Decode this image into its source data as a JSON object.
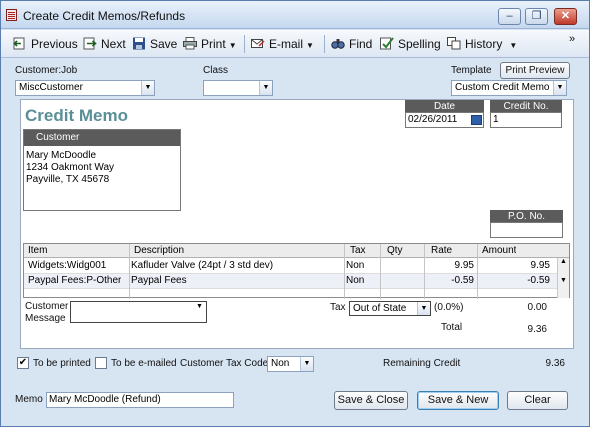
{
  "window": {
    "title": "Create Credit Memos/Refunds",
    "controls": {
      "minimize": "–",
      "restore": "❐",
      "close": "✕"
    }
  },
  "toolbar": {
    "previous": "Previous",
    "next": "Next",
    "save": "Save",
    "print": "Print",
    "email": "E-mail",
    "find": "Find",
    "spelling": "Spelling",
    "history": "History",
    "overflow": "»"
  },
  "customer": {
    "label": "Customer:Job",
    "value": "MiscCustomer"
  },
  "class": {
    "label": "Class",
    "value": ""
  },
  "template": {
    "label": "Template",
    "value": "Custom Credit Memo",
    "preview_button": "Print Preview"
  },
  "form": {
    "title": "Credit Memo",
    "date_label": "Date",
    "date": "02/26/2011",
    "credit_no_label": "Credit No.",
    "credit_no": "1",
    "customer_header": "Customer",
    "address": [
      "Mary McDoodle",
      "1234 Oakmont Way",
      "Payville, TX 45678"
    ],
    "po_label": "P.O. No.",
    "po_value": ""
  },
  "items_table": {
    "headers": [
      "Item",
      "Description",
      "Tax",
      "Qty",
      "Rate",
      "Amount"
    ],
    "rows": [
      {
        "item": "Widgets:Widg001",
        "description": "Kafluder Valve (24pt / 3 std dev)",
        "tax": "Non",
        "qty": "",
        "rate": "9.95",
        "amount": "9.95"
      },
      {
        "item": "Paypal Fees:P-Other",
        "description": "Paypal Fees",
        "tax": "Non",
        "qty": "",
        "rate": "-0.59",
        "amount": "-0.59"
      }
    ]
  },
  "customer_message": {
    "label_line1": "Customer",
    "label_line2": "Message",
    "value": ""
  },
  "tax": {
    "label": "Tax",
    "value": "Out of State",
    "rate": "(0.0%)",
    "amount": "0.00"
  },
  "total": {
    "label": "Total",
    "value": "9.36"
  },
  "options": {
    "to_be_printed": "To be printed",
    "to_be_printed_checked": true,
    "to_be_emailed": "To be e-mailed",
    "to_be_emailed_checked": false,
    "customer_tax_code_label": "Customer Tax Code",
    "customer_tax_code": "Non",
    "remaining_credit_label": "Remaining Credit",
    "remaining_credit": "9.36"
  },
  "memo": {
    "label": "Memo",
    "value": "Mary McDoodle (Refund)"
  },
  "buttons": {
    "save_close": "Save & Close",
    "save_new": "Save & New",
    "clear": "Clear"
  },
  "colors": {
    "window_bg": "#d7e4f2",
    "form_title": "#5b8f98",
    "header_bg": "#5b5b5b"
  }
}
